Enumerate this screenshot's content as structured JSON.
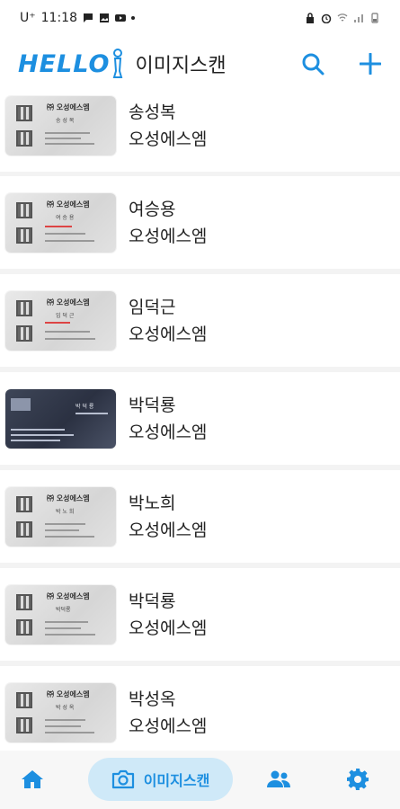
{
  "status_bar": {
    "carrier": "U⁺",
    "time": "11:18",
    "dot": "•"
  },
  "header": {
    "logo_text": "HELLO",
    "title": "이미지스캔",
    "accent_color": "#1d8fe0"
  },
  "cards": [
    {
      "name": "송성복",
      "company": "오성에스엠",
      "card_brand": "㈜ 오성에스엠",
      "card_name": "송 성 복",
      "thumb_style": "light",
      "icon": "business-card-thumbnail"
    },
    {
      "name": "여승용",
      "company": "오성에스엠",
      "card_brand": "㈜ 오성에스엠",
      "card_name": "여 승 용",
      "thumb_style": "light",
      "icon": "business-card-thumbnail"
    },
    {
      "name": "임덕근",
      "company": "오성에스엠",
      "card_brand": "㈜ 오성에스엠",
      "card_name": "임 덕 근",
      "thumb_style": "light",
      "icon": "business-card-thumbnail"
    },
    {
      "name": "박덕룡",
      "company": "오성에스엠",
      "card_brand": "",
      "card_name": "박 덕 룡",
      "thumb_style": "dark",
      "icon": "business-card-thumbnail"
    },
    {
      "name": "박노희",
      "company": "오성에스엠",
      "card_brand": "㈜ 오성에스엠",
      "card_name": "박 노 희",
      "thumb_style": "light",
      "icon": "business-card-thumbnail"
    },
    {
      "name": "박덕룡",
      "company": "오성에스엠",
      "card_brand": "㈜ 오성에스엠",
      "card_name": "박덕룡",
      "thumb_style": "light",
      "icon": "business-card-thumbnail"
    },
    {
      "name": "박성옥",
      "company": "오성에스엠",
      "card_brand": "㈜ 오성에스엠",
      "card_name": "박 성 옥",
      "thumb_style": "light",
      "icon": "business-card-thumbnail"
    }
  ],
  "bottom_nav": {
    "scan_label": "이미지스캔",
    "active": "scan",
    "active_bg": "#cfe9f8"
  }
}
